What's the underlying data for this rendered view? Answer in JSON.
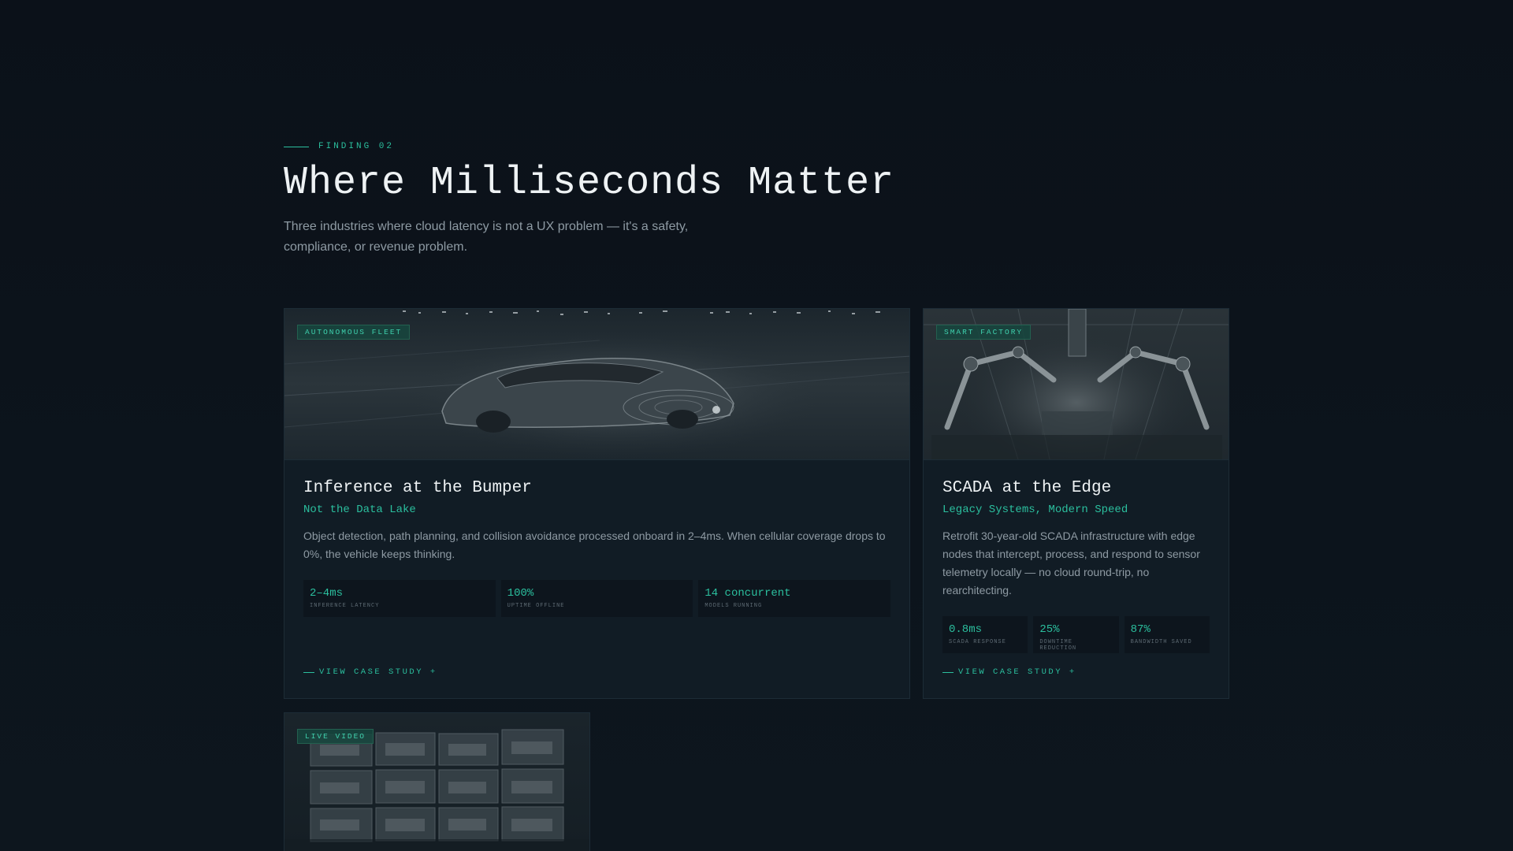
{
  "section": {
    "eyebrow": "FINDING 02",
    "title": "Where Milliseconds Matter",
    "intro": "Three industries where cloud latency is not a UX problem — it's a safety, compliance, or revenue problem."
  },
  "cards": [
    {
      "tag": "AUTONOMOUS FLEET",
      "title": "Inference at the Bumper",
      "subtitle": "Not the Data Lake",
      "description": "Object detection, path planning, and collision avoidance processed onboard in 2–4ms. When cellular coverage drops to 0%, the vehicle keeps thinking.",
      "stats": [
        {
          "value": "2–4ms",
          "label": "INFERENCE LATENCY"
        },
        {
          "value": "100%",
          "label": "UPTIME OFFLINE"
        },
        {
          "value": "14 concurrent",
          "label": "MODELS RUNNING"
        }
      ],
      "cta": "VIEW CASE STUDY +"
    },
    {
      "tag": "SMART FACTORY",
      "title": "SCADA at the Edge",
      "subtitle": "Legacy Systems, Modern Speed",
      "description": "Retrofit 30-year-old SCADA infrastructure with edge nodes that intercept, process, and respond to sensor telemetry locally — no cloud round-trip, no rearchitecting.",
      "stats": [
        {
          "value": "0.8ms",
          "label": "SCADA RESPONSE"
        },
        {
          "value": "25%",
          "label": "DOWNTIME REDUCTION"
        },
        {
          "value": "87%",
          "label": "BANDWIDTH SAVED"
        }
      ],
      "cta": "VIEW CASE STUDY +"
    },
    {
      "tag": "LIVE VIDEO"
    }
  ]
}
